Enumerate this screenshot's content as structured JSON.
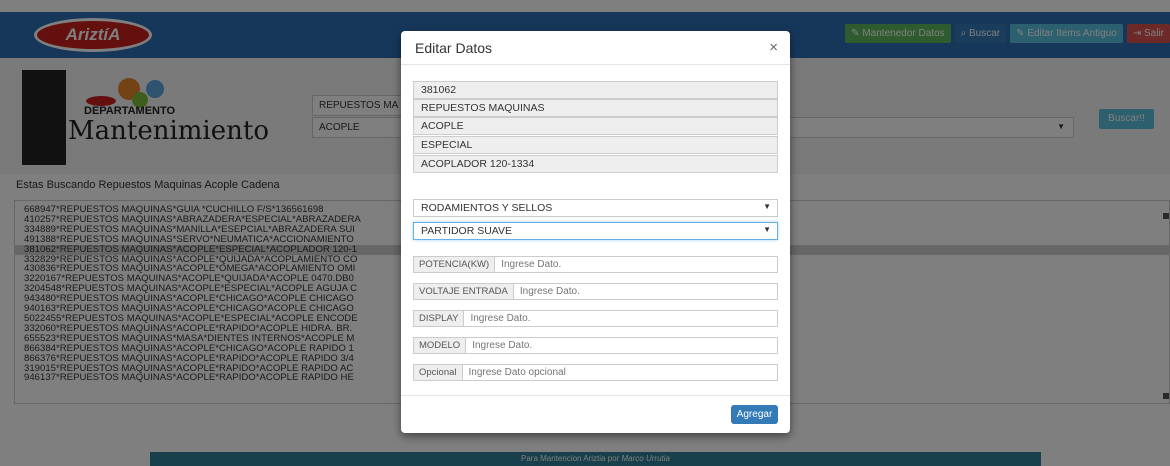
{
  "header": {
    "brand": "AriztíA",
    "nav": [
      {
        "label": "Mantenedor Datos",
        "icon": "pencil-icon",
        "color": "#5cb85c"
      },
      {
        "label": "Buscar",
        "icon": "search-icon",
        "color": "#337ab7"
      },
      {
        "label": "Editar Items Antiguo",
        "icon": "edit-icon",
        "color": "#5bc0de"
      },
      {
        "label": "Salir",
        "icon": "sign-out-icon",
        "color": "#d9534f"
      }
    ]
  },
  "logo": {
    "brand_small": "AriztíA",
    "department": "DEPARTAMENTO",
    "title": "Mantenimiento"
  },
  "filters": {
    "category": "REPUESTOS MA",
    "type": "ACOPLE",
    "buscar_label": "Buscar!!"
  },
  "search_status": "Estas Buscando Repuestos Maquinas Acople Cadena",
  "results": [
    "668947*REPUESTOS MAQUINAS*GUIA *CUCHILLO F/S*136561698",
    "410257*REPUESTOS MAQUINAS*ABRAZADERA*ESPECIAL*ABRAZADERA",
    "334889*REPUESTOS MAQUINAS*MANILLA*ESEPCIAL*ABRAZADERA SUI",
    "491388*REPUESTOS MAQUINAS*SERVO*NEUMATICA*ACCIONAMIENTO",
    "381062*REPUESTOS MAQUINAS*ACOPLE*ESPECIAL*ACOPLADOR 120-1",
    "332829*REPUESTOS MAQUINAS*ACOPLE*QUIJADA*ACOPLAMIENTO CO",
    "430836*REPUESTOS MAQUINAS*ACOPLE*OMEGA*ACOPLAMIENTO OMI",
    "3220167*REPUESTOS MAQUINAS*ACOPLE*QUIJADA*ACOPLE 0470.DB0",
    "3204548*REPUESTOS MAQUINAS*ACOPLE*ESPECIAL*ACOPLE AGUJA C",
    "943480*REPUESTOS MAQUINAS*ACOPLE*CHICAGO*ACOPLE CHICAGO",
    "940163*REPUESTOS MAQUINAS*ACOPLE*CHICAGO*ACOPLE CHICAGO",
    "5022455*REPUESTOS MAQUINAS*ACOPLE*ESPECIAL*ACOPLE ENCODE",
    "332060*REPUESTOS MAQUINAS*ACOPLE*RAPIDO*ACOPLE HIDRA. BR.",
    "655523*REPUESTOS MAQUINAS*MASA*DIENTES INTERNOS*ACOPLE M",
    "866384*REPUESTOS MAQUINAS*ACOPLE*CHICAGO*ACOPLE RAPIDO 1",
    "866376*REPUESTOS MAQUINAS*ACOPLE*RAPIDO*ACOPLE RAPIDO 3/4",
    "319015*REPUESTOS MAQUINAS*ACOPLE*RAPIDO*ACOPLE RAPIDO AC",
    "946137*REPUESTOS MAQUINAS*ACOPLE*RAPIDO*ACOPLE RAPIDO HE"
  ],
  "footer": {
    "text": "Para Mantencion Ariztia por ",
    "author": "Marco Urrutia"
  },
  "modal": {
    "title": "Editar Datos",
    "close": "×",
    "readonly_fields": [
      "381062",
      "REPUESTOS MAQUINAS",
      "ACOPLE",
      "ESPECIAL",
      "ACOPLADOR 120-1334"
    ],
    "select_1": "RODAMIENTOS Y SELLOS",
    "select_2": "PARTIDOR SUAVE",
    "inputs": [
      {
        "label": "POTENCIA(KW)",
        "placeholder": "Ingrese Dato."
      },
      {
        "label": "VOLTAJE ENTRADA",
        "placeholder": "Ingrese Dato."
      },
      {
        "label": "DISPLAY",
        "placeholder": "Ingrese Dato."
      },
      {
        "label": "MODELO",
        "placeholder": "Ingrese Dato."
      },
      {
        "label": "Opcional",
        "placeholder": "Ingrese Dato opcional"
      }
    ],
    "submit_label": "Agregar"
  }
}
